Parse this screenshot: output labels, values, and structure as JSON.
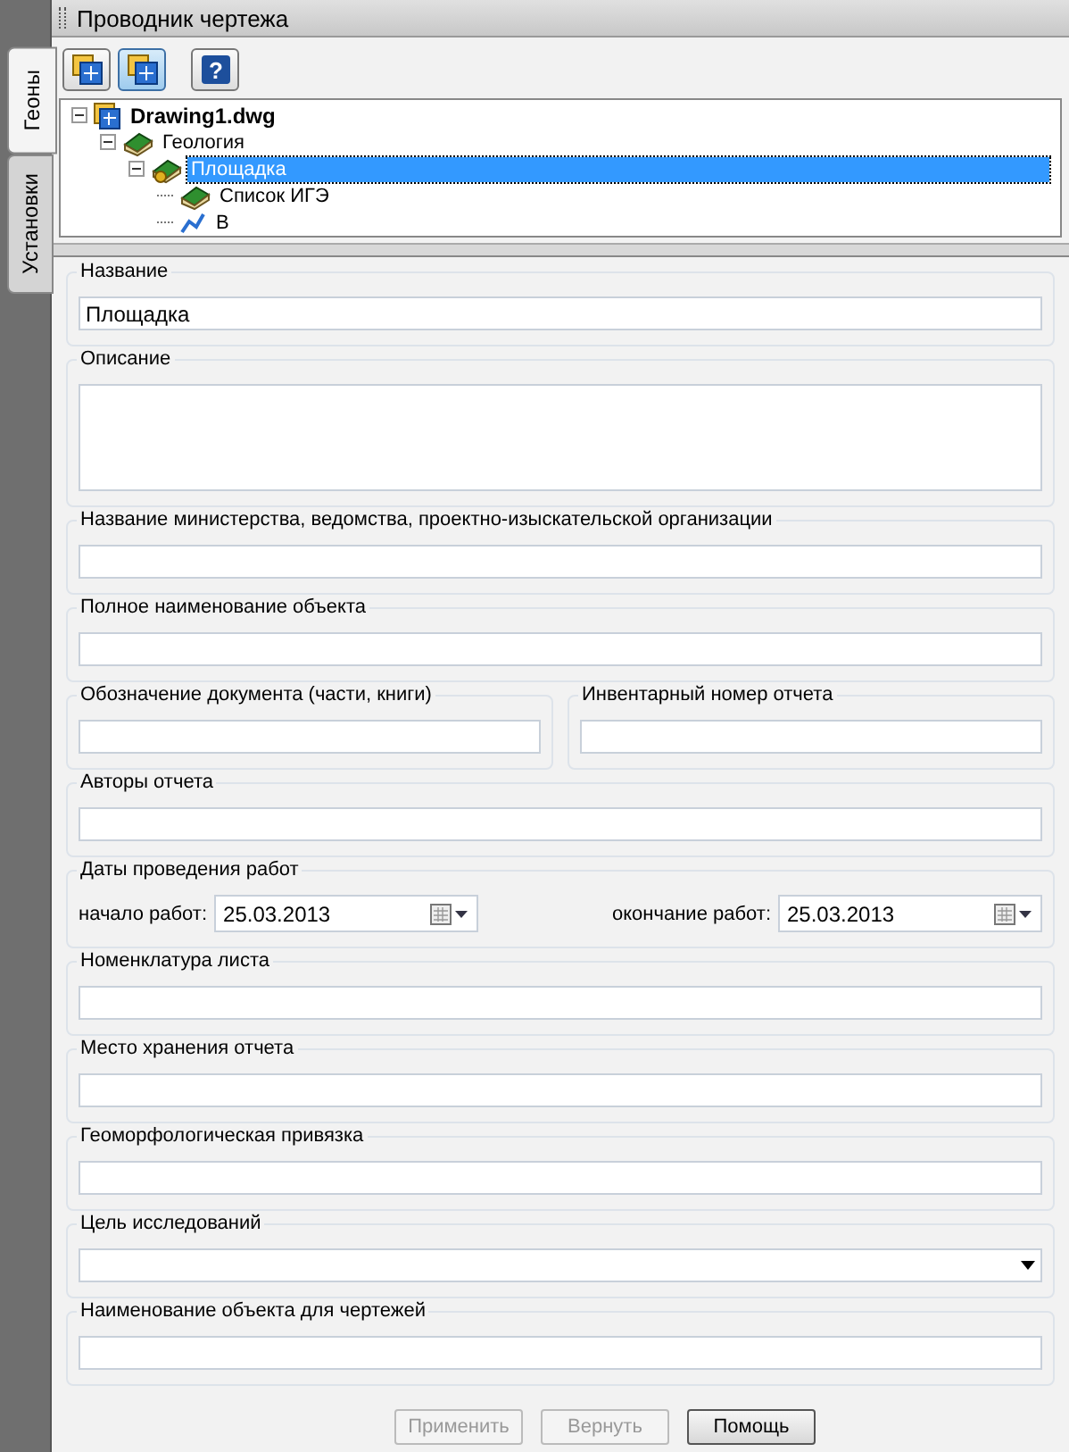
{
  "window": {
    "title": "Проводник чертежа"
  },
  "side_tabs": [
    {
      "label": "Геоны",
      "selected": true
    },
    {
      "label": "Установки",
      "selected": false
    }
  ],
  "toolbar": [
    {
      "kind": "drawing",
      "selected": false
    },
    {
      "kind": "drawing",
      "selected": true
    },
    {
      "kind": "help",
      "glyph": "?",
      "selected": false
    }
  ],
  "tree": [
    {
      "label": "Drawing1.dwg",
      "kind": "drawing",
      "expanded": true,
      "selected": false,
      "children": [
        {
          "label": "Геология",
          "kind": "book",
          "expanded": true,
          "selected": false,
          "children": [
            {
              "label": "Площадка",
              "kind": "site",
              "expanded": true,
              "selected": true,
              "children": [
                {
                  "label": "Список ИГЭ",
                  "kind": "book",
                  "selected": false
                },
                {
                  "label": "В",
                  "kind": "wells",
                  "selected": false
                }
              ]
            }
          ]
        }
      ]
    }
  ],
  "form": [
    {
      "kind": "text",
      "label": "Название",
      "value": "Площадка"
    },
    {
      "kind": "textarea",
      "label": "Описание"
    },
    {
      "kind": "text",
      "label": "Название министерства, ведомства, проектно-изыскательской организации"
    },
    {
      "kind": "text",
      "label": "Полное наименование объекта"
    },
    {
      "kind": "pair",
      "items": [
        {
          "label": "Обозначение документа (части, книги)"
        },
        {
          "label": "Инвентарный номер отчета"
        }
      ]
    },
    {
      "kind": "text",
      "label": "Авторы отчета"
    },
    {
      "kind": "dates",
      "label": "Даты проведения работ",
      "items": [
        {
          "label": "начало работ:",
          "value": "25.03.2013"
        },
        {
          "label": "окончание работ:",
          "value": "25.03.2013"
        }
      ]
    },
    {
      "kind": "text",
      "label": "Номенклатура листа"
    },
    {
      "kind": "text",
      "label": "Место хранения отчета"
    },
    {
      "kind": "text",
      "label": "Геоморфологическая привязка"
    },
    {
      "kind": "select",
      "label": "Цель исследований"
    },
    {
      "kind": "text",
      "label": "Наименование объекта для чертежей"
    }
  ],
  "buttons": [
    {
      "label": "Применить",
      "disabled": true
    },
    {
      "label": "Вернуть",
      "disabled": true
    },
    {
      "label": "Помощь",
      "disabled": false
    }
  ]
}
